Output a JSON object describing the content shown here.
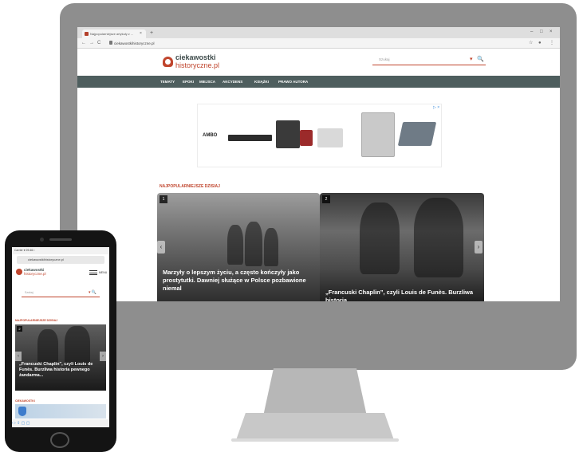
{
  "desktop": {
    "tab_title": "Najpopularniejsze artykuły z ...",
    "tab_close": "×",
    "new_tab": "+",
    "window_controls": [
      "–",
      "□",
      "×"
    ],
    "nav_buttons": [
      "←",
      "→",
      "C"
    ],
    "url": "ciekawostkihistoryczne.pl",
    "extensions": [
      "☆",
      "●",
      "⋮"
    ],
    "logo": {
      "line1": "ciekawostki",
      "line2": "historyczne.pl"
    },
    "search": {
      "placeholder": "Szukaj",
      "dropdown": "▾",
      "icon": "🔍"
    },
    "nav_items": [
      "TEMATY",
      "EPOKI",
      "MIEJSCA",
      "AKCYDENS",
      "KSIĄŻKI",
      "PRAWO AUTORA"
    ],
    "ad": {
      "badge": "▷ ×",
      "brand": "AMBO"
    },
    "section_title": "NAJPOPULARNIEJSZE DZISIAJ",
    "cards": [
      {
        "number": "1",
        "title": "Marzyły o lepszym życiu, a często kończyły jako prostytutki. Dawniej służące w Polsce pozbawione niemal"
      },
      {
        "number": "2",
        "title": "„Francuski Chaplin”, czyli Louis de Funès. Burzliwa historia"
      }
    ],
    "arrow_left": "‹",
    "arrow_right": "›"
  },
  "mobile": {
    "status": "Carrier  ▾    09:46    ▪",
    "url": "ciekawostkihistoryczne.pl",
    "logo": {
      "line1": "ciekawostki",
      "line2": "historyczne.pl"
    },
    "menu_label": "MENU",
    "search": {
      "placeholder": "Szukaj",
      "icons": "▾ 🔍"
    },
    "section_title": "NAJPOPULARNIEJSZE DZISIAJ",
    "card": {
      "number": "2",
      "title": "„Francuski Chaplin”, czyli Louis de Funès. Burzliwa historia pewnego żandarma..."
    },
    "section2_title": "CIEKAWOSTKI",
    "toolbar": "  ‹    ›    ⇪    ▢    ▢",
    "arrow_left": "‹",
    "arrow_right": "›"
  }
}
